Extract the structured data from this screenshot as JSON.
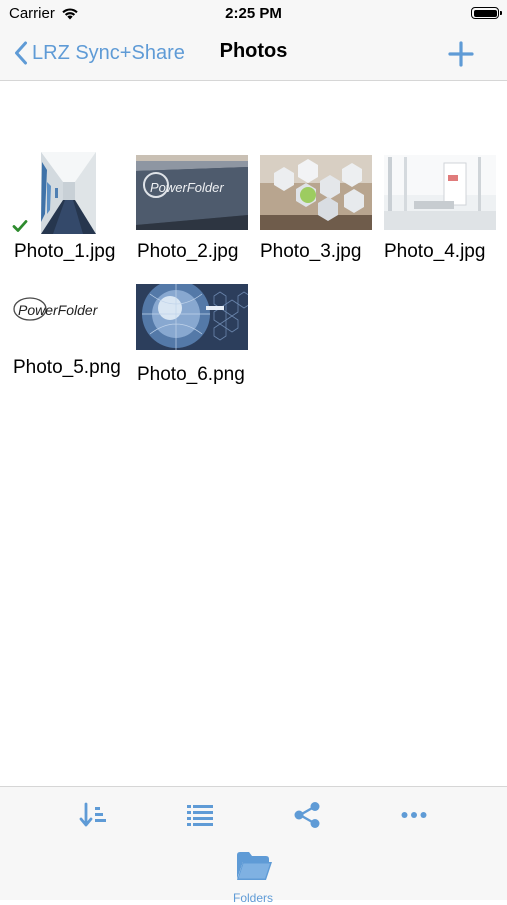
{
  "status": {
    "carrier": "Carrier",
    "time": "2:25 PM"
  },
  "nav": {
    "back_label": "LRZ Sync+Share",
    "title": "Photos"
  },
  "files": [
    {
      "name": "Photo_1.jpg",
      "synced": true
    },
    {
      "name": "Photo_2.jpg"
    },
    {
      "name": "Photo_3.jpg"
    },
    {
      "name": "Photo_4.jpg"
    },
    {
      "name": "Photo_5.png"
    },
    {
      "name": "Photo_6.png"
    }
  ],
  "thumb_text": {
    "brand": "PowerFolder"
  },
  "toolbar": {
    "items": [
      "sort-icon",
      "list-icon",
      "share-icon",
      "more-icon"
    ]
  },
  "tabbar": {
    "folders_label": "Folders"
  },
  "colors": {
    "accent": "#5f9bd6",
    "synced": "#2e8b2e"
  }
}
